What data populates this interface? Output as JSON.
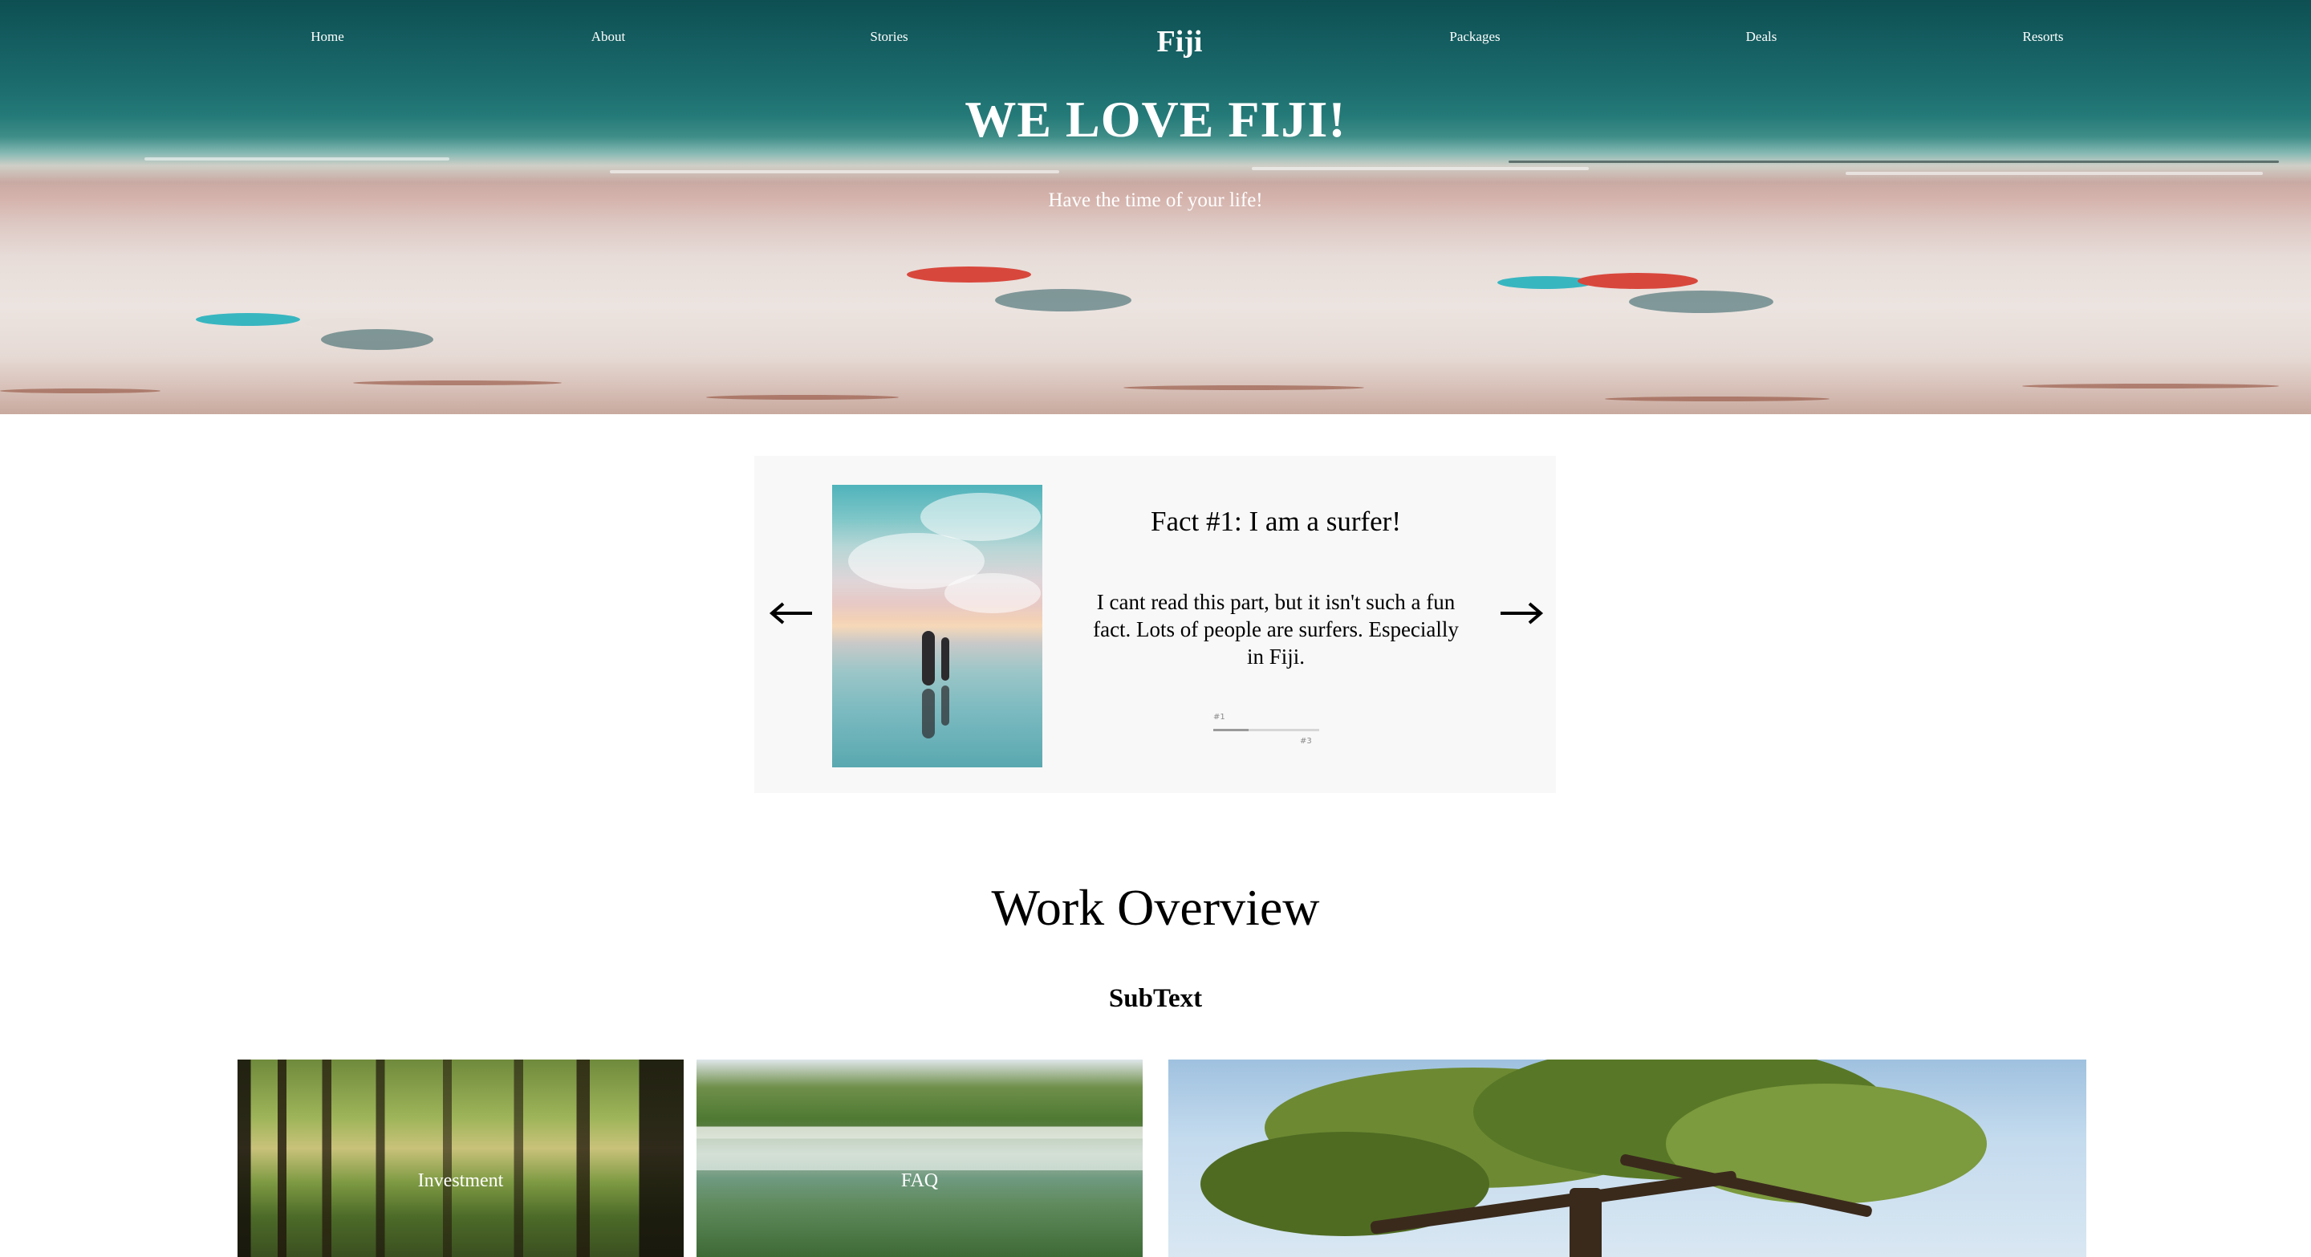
{
  "nav": {
    "links": [
      "Home",
      "About",
      "Stories",
      "Packages",
      "Deals",
      "Resorts"
    ],
    "logo": "Fiji"
  },
  "hero": {
    "title": "WE LOVE FIJI!",
    "subtitle": "Have the time of your life!"
  },
  "slider": {
    "prev_icon": "arrow-left-icon",
    "next_icon": "arrow-right-icon",
    "slide": {
      "title": "Fact #1: I am a surfer!",
      "text": "I cant read this part, but it isn't such a fun fact. Lots of people are surfers. Especially in Fiji."
    },
    "progress": {
      "current": "#1",
      "total": "#3",
      "fraction": 0.33
    }
  },
  "overview": {
    "title": "Work Overview",
    "subtitle": "SubText",
    "tiles": [
      {
        "label": "Investment"
      },
      {
        "label": "FAQ"
      },
      {
        "label": ""
      }
    ]
  },
  "colors": {
    "text_light": "#ffffff",
    "slider_bg": "#f8f8f8",
    "ocean": "#145d60",
    "sand": "#ece4e0"
  }
}
